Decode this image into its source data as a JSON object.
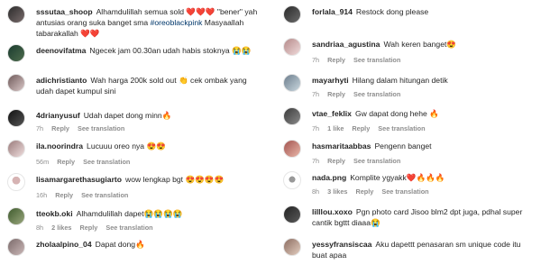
{
  "left": [
    {
      "username": "sssutaa_shoop",
      "text": "Alhamdulillah semua sold ❤️❤️❤️ \"bener\" yah antusias orang suka banget sma ",
      "hashtag": "#oreoblackpink",
      "text_after": " Masyaallah tabarakallah ❤️❤️",
      "meta": {
        "time": "",
        "likes": "",
        "reply": "",
        "translation": ""
      }
    },
    {
      "username": "deenovifatma",
      "text": "Ngecek jam 00.30an udah habis stoknya 😭😭",
      "meta": {
        "time": "",
        "likes": "",
        "reply": "",
        "translation": ""
      }
    },
    {
      "username": "adichristianto",
      "text": "Wah harga 200k sold out 👏 cek ombak yang udah dapet kumpul sini",
      "meta": {
        "time": "",
        "likes": "",
        "reply": "",
        "translation": ""
      }
    },
    {
      "username": "4drianyusuf",
      "text": "Udah dapet dong minn🔥",
      "meta": {
        "time": "7h",
        "likes": "",
        "reply": "Reply",
        "translation": "See translation"
      }
    },
    {
      "username": "ila.noorindra",
      "text": "Lucuuu oreo nya 😍😍",
      "meta": {
        "time": "56m",
        "likes": "",
        "reply": "Reply",
        "translation": "See translation"
      }
    },
    {
      "username": "lisamargarethasugiarto",
      "text": "wow lengkap bgt 😍😍😍😍",
      "meta": {
        "time": "16h",
        "likes": "",
        "reply": "Reply",
        "translation": "See translation"
      }
    },
    {
      "username": "tteokb.oki",
      "text": "Alhamdulillah dapet😭😭😭😭",
      "meta": {
        "time": "8h",
        "likes": "2 likes",
        "reply": "Reply",
        "translation": "See translation"
      }
    },
    {
      "username": "zholaalpino_04",
      "text": "Dapat dong🔥",
      "meta": {
        "time": "",
        "likes": "",
        "reply": "",
        "translation": ""
      }
    }
  ],
  "right": [
    {
      "username": "forlala_914",
      "text": "Restock dong please",
      "meta": {
        "time": "",
        "likes": "",
        "reply": "",
        "translation": ""
      }
    },
    {
      "username": "sandriaa_agustina",
      "text": "Wah keren banget😍",
      "meta": {
        "time": "7h",
        "likes": "",
        "reply": "Reply",
        "translation": "See translation"
      }
    },
    {
      "username": "mayarhyti",
      "text": "Hilang dalam hitungan detik",
      "meta": {
        "time": "7h",
        "likes": "",
        "reply": "Reply",
        "translation": "See translation"
      }
    },
    {
      "username": "vtae_feklix",
      "text": "Gw dapat dong hehe 🔥",
      "meta": {
        "time": "7h",
        "likes": "1 like",
        "reply": "Reply",
        "translation": "See translation"
      }
    },
    {
      "username": "hasmaritaabbas",
      "text": "Pengenn banget",
      "meta": {
        "time": "7h",
        "likes": "",
        "reply": "Reply",
        "translation": "See translation"
      }
    },
    {
      "username": "nada.png",
      "text": "Komplite ygyakk❤️🔥🔥🔥",
      "meta": {
        "time": "8h",
        "likes": "3 likes",
        "reply": "Reply",
        "translation": "See translation"
      }
    },
    {
      "username": "lilllou.xoxo",
      "text": "Pgn photo card Jisoo blm2 dpt juga, pdhal super cantik bgttt diaaa😭",
      "meta": {
        "time": "",
        "likes": "",
        "reply": "",
        "translation": ""
      }
    },
    {
      "username": "yessyfransiscaa",
      "text": "Aku dapettt penasaran sm unique code itu buat apaa",
      "meta": {
        "time": "",
        "likes": "",
        "reply": "",
        "translation": ""
      }
    }
  ]
}
